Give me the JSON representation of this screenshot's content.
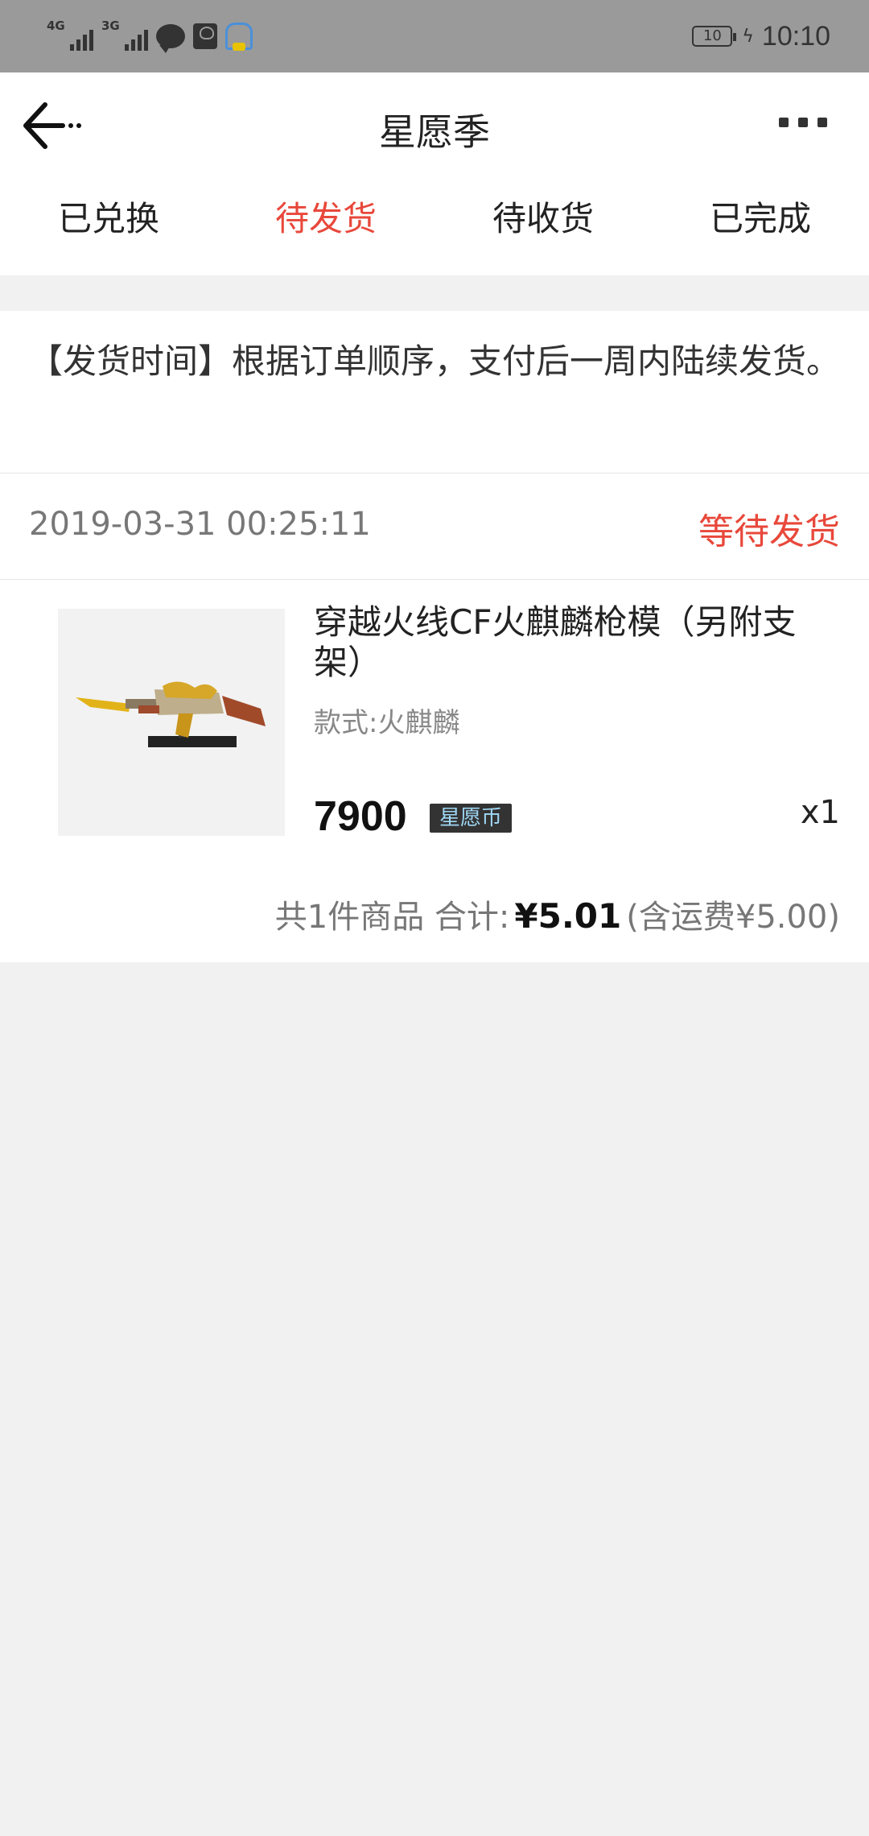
{
  "status_bar": {
    "network_1": "4G",
    "network_2": "3G",
    "battery_level": "10",
    "time": "10:10",
    "icons": [
      "signal-icon",
      "signal-icon",
      "chat-icon",
      "huawei-icon",
      "lock-icon",
      "battery-icon",
      "charging-icon"
    ]
  },
  "header": {
    "title": "星愿季",
    "back_icon": "arrow-left-icon",
    "more_icon": "more-dots-icon"
  },
  "tabs": [
    {
      "label": "已兑换",
      "active": false
    },
    {
      "label": "待发货",
      "active": true
    },
    {
      "label": "待收货",
      "active": false
    },
    {
      "label": "已完成",
      "active": false
    }
  ],
  "notice": {
    "text": "【发货时间】根据订单顺序，支付后一周内陆续发货。"
  },
  "order": {
    "time": "2019-03-31 00:25:11",
    "status": "等待发货",
    "product": {
      "name": "穿越火线CF火麒麟枪模（另附支架）",
      "variant": "款式:火麒麟",
      "price": "7900",
      "currency": "星愿币",
      "quantity": "x1"
    },
    "summary": {
      "count_text": "共1件商品 合计:",
      "total": "¥5.01",
      "shipping": "(含运费¥5.00)"
    }
  },
  "colors": {
    "accent": "#e8483b",
    "status_bar": "#9a9a9a",
    "background": "#f1f1f1"
  }
}
